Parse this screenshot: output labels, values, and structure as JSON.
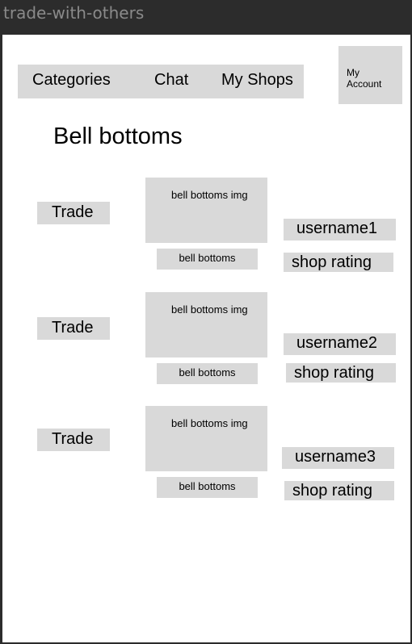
{
  "window": {
    "title": "trade-with-others"
  },
  "nav": {
    "items": [
      "Categories",
      "Chat",
      "My Shops"
    ],
    "account": "My Account"
  },
  "page": {
    "title": "Bell bottoms"
  },
  "listings": [
    {
      "trade_label": "Trade",
      "image_label": "bell bottoms img",
      "product_name": "bell bottoms",
      "username": "username1",
      "rating_label": "shop rating"
    },
    {
      "trade_label": "Trade",
      "image_label": "bell bottoms img",
      "product_name": "bell bottoms",
      "username": "username2",
      "rating_label": "shop rating"
    },
    {
      "trade_label": "Trade",
      "image_label": "bell bottoms img",
      "product_name": "bell bottoms",
      "username": "username3",
      "rating_label": "shop rating"
    }
  ]
}
